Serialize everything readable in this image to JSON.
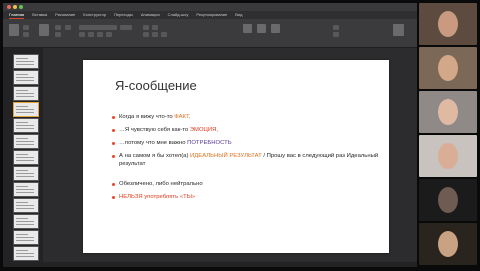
{
  "window": {
    "title": "",
    "ribbon_tabs": [
      "Главная",
      "Вставка",
      "Рисование",
      "Конструктор",
      "Переходы",
      "Анимация",
      "Слайд-шоу",
      "Рецензирование",
      "Вид"
    ]
  },
  "slide": {
    "title": "Я-сообщение",
    "bullets": [
      {
        "parts": [
          {
            "text": "Когда я вижу что-то ",
            "style": "normal"
          },
          {
            "text": "ФАКТ,",
            "style": "orange"
          }
        ]
      },
      {
        "parts": [
          {
            "text": "…Я чувствую себя как-то ",
            "style": "normal"
          },
          {
            "text": "ЭМОЦИЯ,",
            "style": "red"
          }
        ]
      },
      {
        "parts": [
          {
            "text": "…потому что мне важно ",
            "style": "normal"
          },
          {
            "text": "ПОТРЕБНОСТЬ",
            "style": "purple"
          }
        ]
      },
      {
        "parts": [
          {
            "text": "А на самом я бы хотел(а) ",
            "style": "normal"
          },
          {
            "text": "ИДЕАЛЬНЫЙ РЕЗУЛЬТАТ",
            "style": "orange"
          },
          {
            "text": " / Прошу вас в следующий раз Идеальный результат",
            "style": "normal"
          }
        ]
      },
      {
        "parts": [
          {
            "text": "Обезличено, либо нейтрально",
            "style": "normal"
          }
        ],
        "gap": true
      },
      {
        "parts": [
          {
            "text": "НЕЛЬЗЯ употреблять «ТЫ»",
            "style": "red"
          }
        ]
      }
    ]
  },
  "status": {
    "text": ""
  },
  "participants": [
    {
      "name": "participant-1",
      "bg": "#5d4b3f",
      "face": "#c99a80"
    },
    {
      "name": "participant-2",
      "bg": "#7b6856",
      "face": "#d3a889"
    },
    {
      "name": "participant-3",
      "bg": "#8f8a87",
      "face": "#e0b9a2"
    },
    {
      "name": "participant-4",
      "bg": "#c8c3bf",
      "face": "#d9ad96"
    },
    {
      "name": "participant-5",
      "bg": "#1b1b1b",
      "face": "#6e5c52"
    },
    {
      "name": "participant-6",
      "bg": "#2a241f",
      "face": "#c8a283"
    }
  ],
  "colors": {
    "bullet_dot": "#e8462a",
    "orange": "#e0701f",
    "red": "#e23a1f",
    "purple": "#5a3a9a"
  }
}
